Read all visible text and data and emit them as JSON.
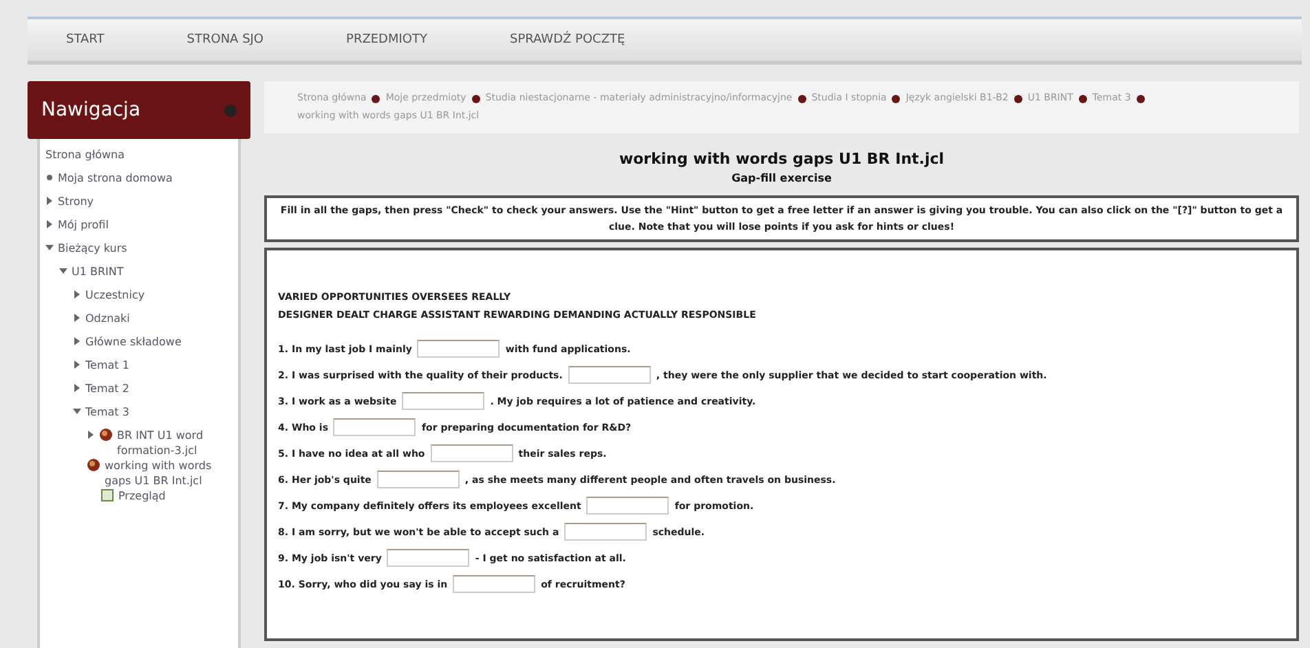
{
  "top_nav": [
    {
      "label": "START"
    },
    {
      "label": "STRONA SJO"
    },
    {
      "label": "PRZEDMIOTY"
    },
    {
      "label": "SPRAWDŹ POCZTĘ"
    }
  ],
  "navigation": {
    "title": "Nawigacja",
    "tree": [
      {
        "label": "Strona główna",
        "kind": "plain"
      },
      {
        "label": "Moja strona domowa",
        "kind": "bullet"
      },
      {
        "label": "Strony",
        "kind": "branch",
        "expanded": false
      },
      {
        "label": "Mój profil",
        "kind": "branch",
        "expanded": false
      },
      {
        "label": "Bieżący kurs",
        "kind": "branch",
        "expanded": true,
        "children": [
          {
            "label": "U1 BRINT",
            "kind": "branch",
            "expanded": true,
            "children": [
              {
                "label": "Uczestnicy",
                "kind": "branch",
                "expanded": false
              },
              {
                "label": "Odznaki",
                "kind": "branch",
                "expanded": false
              },
              {
                "label": "Główne składowe",
                "kind": "branch",
                "expanded": false
              },
              {
                "label": "Temat 1",
                "kind": "branch",
                "expanded": false
              },
              {
                "label": "Temat 2",
                "kind": "branch",
                "expanded": false
              },
              {
                "label": "Temat 3",
                "kind": "branch",
                "expanded": true,
                "children": [
                  {
                    "label": "BR INT U1 word formation-3.jcl",
                    "kind": "activity",
                    "expanded": false
                  },
                  {
                    "label": "working with words gaps U1 BR Int.jcl",
                    "kind": "activity-current",
                    "children": [
                      {
                        "label": "Przegląd",
                        "kind": "page"
                      }
                    ]
                  }
                ]
              }
            ]
          }
        ]
      }
    ]
  },
  "breadcrumb": [
    "Strona główna",
    "Moje przedmioty",
    "Studia niestacjonarne - materiały administracyjno/informacyjne",
    "Studia I stopnia",
    "Język angielski B1-B2",
    "U1 BRINT",
    "Temat 3",
    "working with words gaps U1 BR Int.jcl"
  ],
  "exercise": {
    "title": "working with words gaps U1 BR Int.jcl",
    "subtitle": "Gap-fill exercise",
    "instructions": "Fill in all the gaps, then press \"Check\" to check your answers. Use the \"Hint\" button to get a free letter if an answer is giving you trouble. You can also click on the \"[?]\" button to get a clue. Note that you will lose points if you ask for hints or clues!",
    "word_bank": [
      "VARIED OPPORTUNITIES OVERSEES REALLY",
      "DESIGNER DEALT CHARGE ASSISTANT REWARDING DEMANDING ACTUALLY RESPONSIBLE"
    ],
    "questions": [
      {
        "before": "1. In my last job I mainly",
        "after": "with fund applications."
      },
      {
        "before": "2. I was surprised with the quality of their products.",
        "after": ", they were the only supplier that we decided to start cooperation with."
      },
      {
        "before": "3. I work as a website",
        "after": ". My job requires a lot of patience and creativity."
      },
      {
        "before": "4. Who is",
        "after": "for preparing documentation for R&D?"
      },
      {
        "before": "5. I have no idea at all who",
        "after": "their sales reps."
      },
      {
        "before": "6. Her job's quite",
        "after": ", as she meets many different people and often travels on business."
      },
      {
        "before": "7. My company definitely offers its employees excellent",
        "after": "for promotion."
      },
      {
        "before": "8. I am sorry, but we won't be able to accept such a",
        "after": "schedule."
      },
      {
        "before": "9. My job isn't very",
        "after": "- I get no satisfaction at all."
      },
      {
        "before": "10. Sorry, who did you say is in",
        "after": "of recruitment?"
      }
    ]
  }
}
